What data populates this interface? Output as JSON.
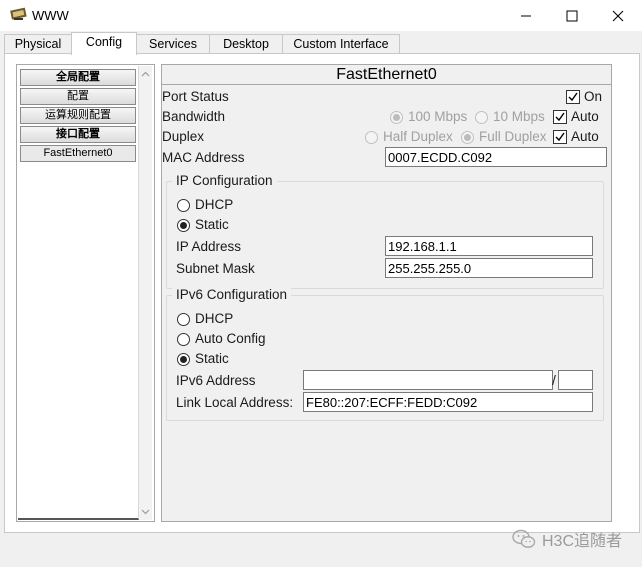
{
  "window": {
    "title": "WWW",
    "minimize": "—",
    "maximize": "☐",
    "close": "✕"
  },
  "tabs": [
    {
      "label": "Physical"
    },
    {
      "label": "Config"
    },
    {
      "label": "Services"
    },
    {
      "label": "Desktop"
    },
    {
      "label": "Custom Interface"
    }
  ],
  "sidebar": {
    "items": [
      {
        "label": "全局配置"
      },
      {
        "label": "配置"
      },
      {
        "label": "运算规则配置"
      },
      {
        "label": "接口配置"
      },
      {
        "label": "FastEthernet0"
      }
    ]
  },
  "panel": {
    "title": "FastEthernet0",
    "port_status_label": "Port Status",
    "port_on_label": "On",
    "bandwidth_label": "Bandwidth",
    "bw_100": "100 Mbps",
    "bw_10": "10 Mbps",
    "auto_label": "Auto",
    "duplex_label": "Duplex",
    "half_duplex": "Half Duplex",
    "full_duplex": "Full Duplex",
    "duplex_auto_label": "Auto",
    "mac_label": "MAC Address",
    "mac_value": "0007.ECDD.C092"
  },
  "ipv4": {
    "title": "IP Configuration",
    "dhcp": "DHCP",
    "static": "Static",
    "ip_label": "IP Address",
    "ip_value": "192.168.1.1",
    "mask_label": "Subnet Mask",
    "mask_value": "255.255.255.0"
  },
  "ipv6": {
    "title": "IPv6 Configuration",
    "dhcp": "DHCP",
    "auto": "Auto Config",
    "static": "Static",
    "addr_label": "IPv6 Address",
    "addr_value": "",
    "slash": "/",
    "prefix_value": "",
    "link_local_label": "Link Local Address:",
    "link_local_value": "FE80::207:ECFF:FEDD:C092"
  },
  "watermark": {
    "text": "H3C追随者"
  }
}
